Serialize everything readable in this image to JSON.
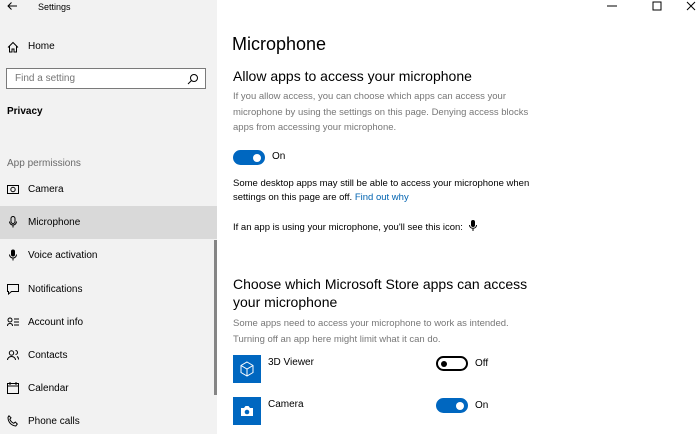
{
  "window": {
    "title": "Settings"
  },
  "sidebar": {
    "home_label": "Home",
    "search_placeholder": "Find a setting",
    "section_title": "Privacy",
    "group_title": "App permissions",
    "items": [
      {
        "label": "Camera",
        "icon": "camera-icon"
      },
      {
        "label": "Microphone",
        "icon": "microphone-icon"
      },
      {
        "label": "Voice activation",
        "icon": "voice-activation-icon"
      },
      {
        "label": "Notifications",
        "icon": "notifications-icon"
      },
      {
        "label": "Account info",
        "icon": "account-info-icon"
      },
      {
        "label": "Contacts",
        "icon": "contacts-icon"
      },
      {
        "label": "Calendar",
        "icon": "calendar-icon"
      },
      {
        "label": "Phone calls",
        "icon": "phone-icon"
      }
    ]
  },
  "main": {
    "title": "Microphone",
    "allow_heading": "Allow apps to access your microphone",
    "allow_desc": "If you allow access, you can choose which apps can access your microphone by using the settings on this page. Denying access blocks apps from accessing your microphone.",
    "allow_toggle_label": "On",
    "desktop_note": "Some desktop apps may still be able to access your microphone when settings on this page are off.",
    "find_out_link": "Find out why",
    "icon_note": "If an app is using your microphone, you'll see this icon:",
    "store_heading_line1": "Choose which Microsoft Store apps can access",
    "store_heading_line2": "your microphone",
    "store_desc": "Some apps need to access your microphone to work as intended. Turning off an app here might limit what it can do.",
    "apps": [
      {
        "name": "3D Viewer",
        "state": "Off",
        "icon": "3d-viewer-icon"
      },
      {
        "name": "Camera",
        "state": "On",
        "icon": "camera-app-icon"
      }
    ]
  },
  "colors": {
    "accent": "#0067c0",
    "link": "#0063b1",
    "sidebar_bg": "#f2f2f2",
    "selected_bg": "#d9d9d9"
  }
}
